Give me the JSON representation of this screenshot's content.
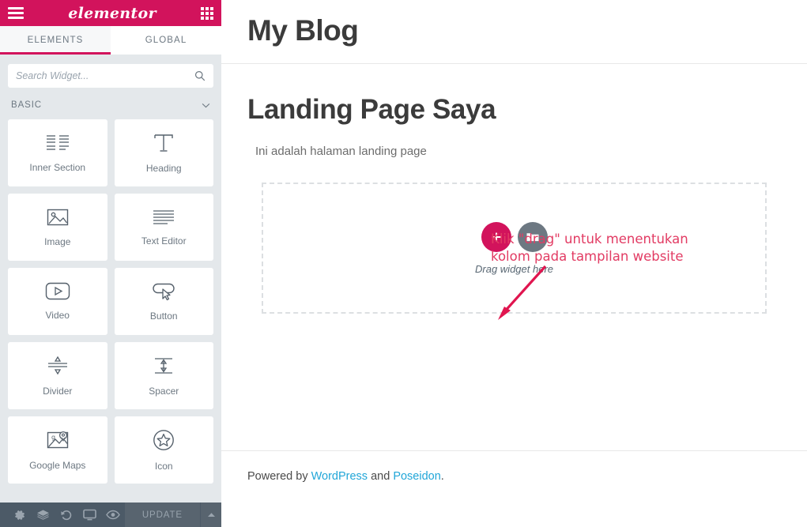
{
  "panel": {
    "brand": "elementor",
    "menu_icon": "hamburger-icon",
    "apps_icon": "grid-apps-icon",
    "tabs": [
      {
        "label": "ELEMENTS",
        "active": true
      },
      {
        "label": "GLOBAL",
        "active": false
      }
    ],
    "search": {
      "placeholder": "Search Widget...",
      "value": "",
      "icon": "search-icon"
    },
    "section": {
      "label": "BASIC",
      "chevron": "chevron-down-icon"
    },
    "widgets": [
      {
        "label": "Inner Section",
        "icon": "inner-section-icon"
      },
      {
        "label": "Heading",
        "icon": "heading-t-icon"
      },
      {
        "label": "Image",
        "icon": "image-icon"
      },
      {
        "label": "Text Editor",
        "icon": "text-lines-icon"
      },
      {
        "label": "Video",
        "icon": "video-play-icon"
      },
      {
        "label": "Button",
        "icon": "button-cursor-icon"
      },
      {
        "label": "Divider",
        "icon": "divider-icon"
      },
      {
        "label": "Spacer",
        "icon": "spacer-icon"
      },
      {
        "label": "Google Maps",
        "icon": "google-maps-icon"
      },
      {
        "label": "Icon",
        "icon": "star-circle-icon"
      }
    ],
    "footer": {
      "tools": [
        {
          "name": "settings-gear-icon",
          "title": "Settings"
        },
        {
          "name": "navigator-layers-icon",
          "title": "Navigator"
        },
        {
          "name": "history-icon",
          "title": "History"
        },
        {
          "name": "responsive-monitor-icon",
          "title": "Responsive Mode"
        },
        {
          "name": "preview-eye-icon",
          "title": "Preview Changes"
        }
      ],
      "update_label": "UPDATE",
      "update_caret": "caret-up-icon"
    },
    "collapse": {
      "icon": "chevron-left-icon"
    }
  },
  "canvas": {
    "site_title": "My Blog",
    "page_heading": "Landing Page Saya",
    "page_subtitle": "Ini adalah halaman landing page",
    "annotation": "Klik \"drag\" untuk menentukan\nkolom pada tampilan website",
    "dropzone": {
      "add_icon": "plus-icon",
      "folder_icon": "folder-template-icon",
      "hint": "Drag widget here"
    },
    "footer": {
      "prefix": "Powered by ",
      "link1": "WordPress",
      "middle": " and ",
      "link2": "Poseidon",
      "suffix": "."
    }
  },
  "colors": {
    "brand_pink": "#d2135c",
    "annotation_red": "#e23b63",
    "panel_bg": "#e4e8eb",
    "toolbar_bg": "#4c5a67",
    "link_blue": "#21a6d8"
  }
}
